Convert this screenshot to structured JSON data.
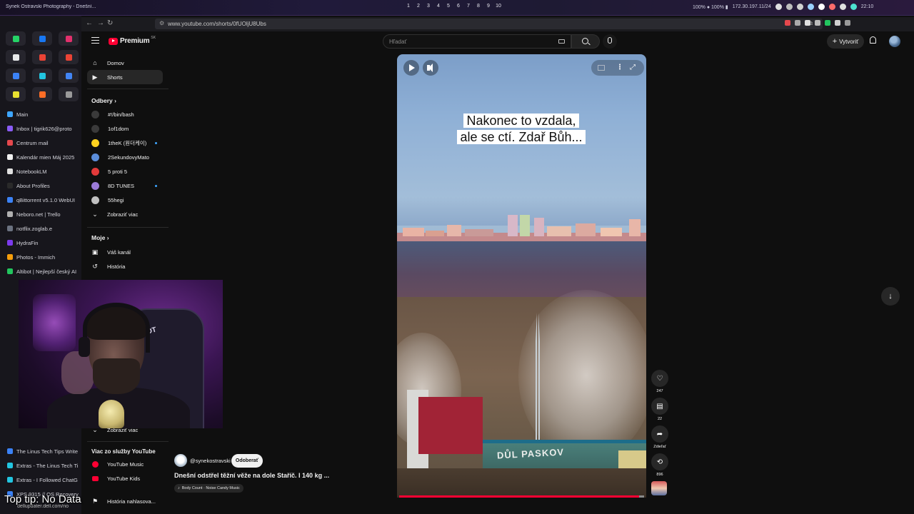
{
  "system_bar": {
    "window_title": "Synek Ostravski Photography - Dnešní...",
    "workspaces": [
      "1",
      "2",
      "3",
      "4",
      "5",
      "6",
      "7",
      "8",
      "9",
      "10"
    ],
    "status": "100% ● 100% ▮",
    "ip": "172.30.197.11/24",
    "time": "22:10"
  },
  "browser": {
    "url": "www.youtube.com/shorts/0fUOljU8Ubs",
    "back": "←",
    "forward": "→",
    "reload": "↻",
    "url_icons": "⧉ ▭"
  },
  "browser_sidebar": {
    "pinned": [
      {
        "name": "whatsapp",
        "color": "#25d366"
      },
      {
        "name": "messenger",
        "color": "#1877f2"
      },
      {
        "name": "instagram",
        "color": "#e1306c"
      },
      {
        "name": "x",
        "color": "#e7e9ea"
      },
      {
        "name": "gmail",
        "color": "#ea4335"
      },
      {
        "name": "gmail-2",
        "color": "#ea4335"
      },
      {
        "name": "chat",
        "color": "#3b82f6"
      },
      {
        "name": "app-cyan",
        "color": "#22c5e0"
      },
      {
        "name": "app-blue",
        "color": "#4285f4"
      },
      {
        "name": "app-yellow",
        "color": "#e8e030"
      },
      {
        "name": "gitlab",
        "color": "#fc6d26"
      },
      {
        "name": "app-gray",
        "color": "#9a9a9a"
      }
    ],
    "tabs": [
      {
        "label": "Main",
        "color": "#3ea6ff"
      },
      {
        "label": "Inbox | tigrik626@proto",
        "color": "#8a5cf6"
      },
      {
        "label": "Centrum mail",
        "color": "#e5484d"
      },
      {
        "label": "Kalendár mien Máj 2025",
        "color": "#f0f0f0"
      },
      {
        "label": "NotebookLM",
        "color": "#e0e0e0"
      },
      {
        "label": "About Profiles",
        "color": "#2a2a2a"
      },
      {
        "label": "qBittorrent v5.1.0 WebUI",
        "color": "#3b82f6"
      },
      {
        "label": "Neboro.net | Trello",
        "color": "#b0b0b0"
      },
      {
        "label": "notflix.zoglab.e",
        "color": "#6b7280"
      },
      {
        "label": "HydraFin",
        "color": "#7c3aed"
      },
      {
        "label": "Photos - Immich",
        "color": "#f59e0b"
      },
      {
        "label": "Altibot | Nejlepší český AI",
        "color": "#22c55e"
      }
    ],
    "tabs_bottom": [
      {
        "label": "The Linus Tech Tips Write",
        "color": "#3b82f6"
      },
      {
        "label": "Extras - The Linus Tech Ti",
        "color": "#22c5e0"
      },
      {
        "label": "Extras - I Followed ChatG",
        "color": "#22c5e0"
      },
      {
        "label": "XPS 9315 // OS Recovery",
        "color": "#3b82f6"
      }
    ],
    "bottom_url": "dellupdater.dell.com/no"
  },
  "header": {
    "logo_text": "Premium",
    "logo_region": "SK",
    "search_placeholder": "Hľadať",
    "create_label": "Vytvoriť"
  },
  "guide": {
    "home": "Domov",
    "shorts": "Shorts",
    "subscriptions_title": "Odbery",
    "channels": [
      {
        "name": "#!/bin/bash",
        "color": "#3a3a3a",
        "dot": false
      },
      {
        "name": "1of1dom",
        "color": "#3a3a3a",
        "dot": false
      },
      {
        "name": "1theK (원더케이)",
        "color": "#ffd21f",
        "dot": true
      },
      {
        "name": "2SekundovyMato",
        "color": "#5b8dd9",
        "dot": false
      },
      {
        "name": "5 proti 5",
        "color": "#e23a3a",
        "dot": false
      },
      {
        "name": "8D TUNES",
        "color": "#9b7bd8",
        "dot": true
      },
      {
        "name": "55hegi",
        "color": "#c0c0c0",
        "dot": false
      }
    ],
    "show_more": "Zobraziť viac",
    "you_title": "Moje",
    "your_channel": "Váš kanál",
    "history": "História",
    "show_more_2": "Zobraziť viac",
    "more_from_title": "Viac zo služby YouTube",
    "yt_music": "YouTube Music",
    "yt_kids": "YouTube Kids",
    "report_history": "História nahlasova..."
  },
  "webcam": {
    "chair_logo": "SOOT"
  },
  "short": {
    "caption": "Nakonec to vzdala, ale se ctí. Zdař Bůh...",
    "scene_sign": "DŮL PASKOV",
    "channel": "@synekostravski",
    "subscribe_label": "Odoberať",
    "title": "Dnešní odstřel těžní věže na dole Staříč. I 140 kg ...",
    "music": "Body Count · Noise Candy Music",
    "progress_fraction": 0.98
  },
  "actions": {
    "likes": "247",
    "comments": "22",
    "share": "Zdieľať",
    "remix": "896"
  },
  "overlay": {
    "top_tip": "Top tip: No Data"
  }
}
